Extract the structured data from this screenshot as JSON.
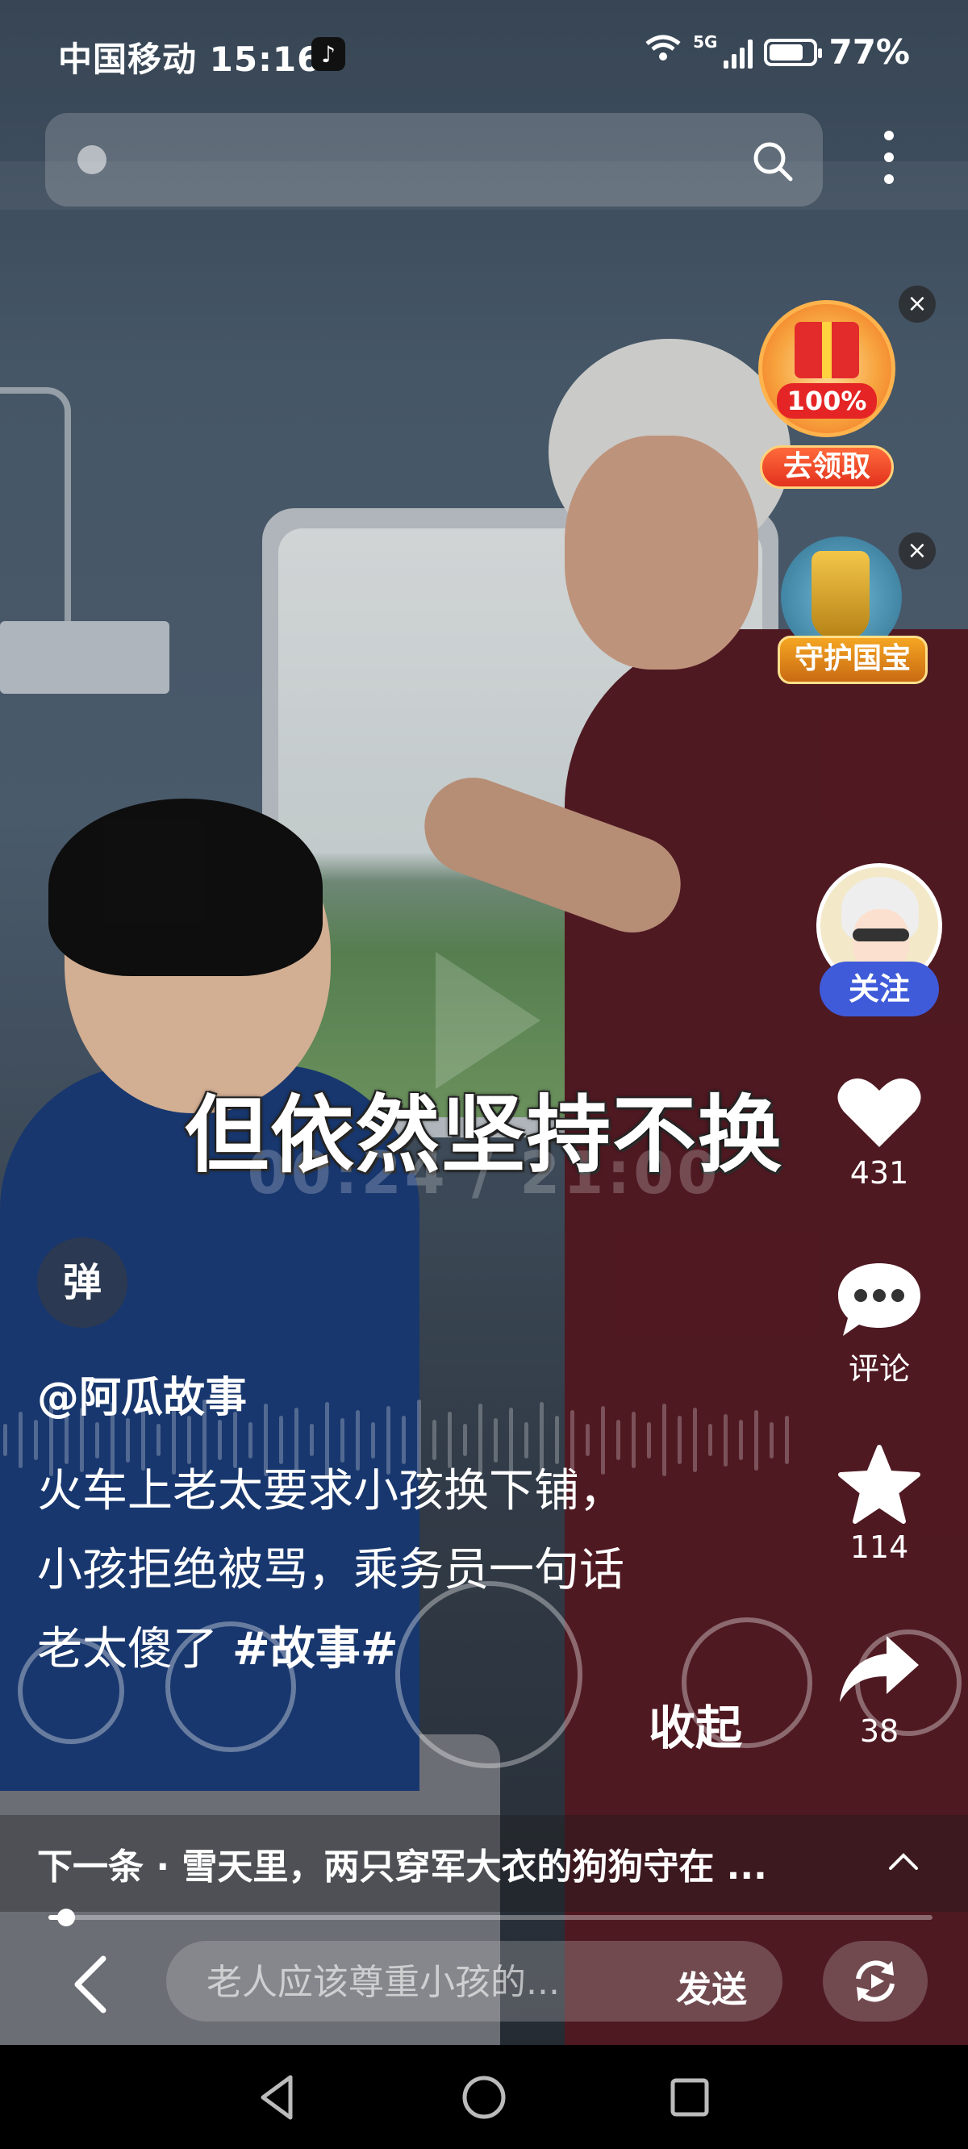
{
  "status_bar": {
    "carrier_time": "中国移动 15:16",
    "network": "5G",
    "battery": "77%",
    "battery_level": 0.77
  },
  "search": {
    "placeholder": ""
  },
  "widgets": {
    "gift_percent": "100%",
    "gift_label": "去领取",
    "treasure_label": "守护国宝"
  },
  "actions": {
    "follow": "关注",
    "likes": "431",
    "comment_label": "评论",
    "favorites": "114",
    "shares": "38"
  },
  "video": {
    "subtitle": "但依然坚持不换",
    "timecode": "00:24 / 21:00",
    "progress": 0.02,
    "danmu": "弹",
    "author": "@阿瓜故事",
    "desc_line1": "火车上老太要求小孩换下铺，",
    "desc_line2": "小孩拒绝被骂，乘务员一句话",
    "desc_line3": "老太傻了 ",
    "desc_tag": "#故事#",
    "collapse": "收起"
  },
  "next": {
    "text": "下一条 · 雪天里，两只穿军大衣的狗狗守在 ..."
  },
  "comment": {
    "placeholder": "老人应该尊重小孩的...",
    "send": "发送"
  },
  "icons": [
    "search-icon",
    "more-icon",
    "close-icon",
    "gift-icon",
    "heart-icon",
    "comment-icon",
    "star-icon",
    "share-icon",
    "chevron-up-icon",
    "back-icon",
    "replay-icon",
    "nav-back-icon",
    "nav-home-icon",
    "nav-recents-icon"
  ]
}
